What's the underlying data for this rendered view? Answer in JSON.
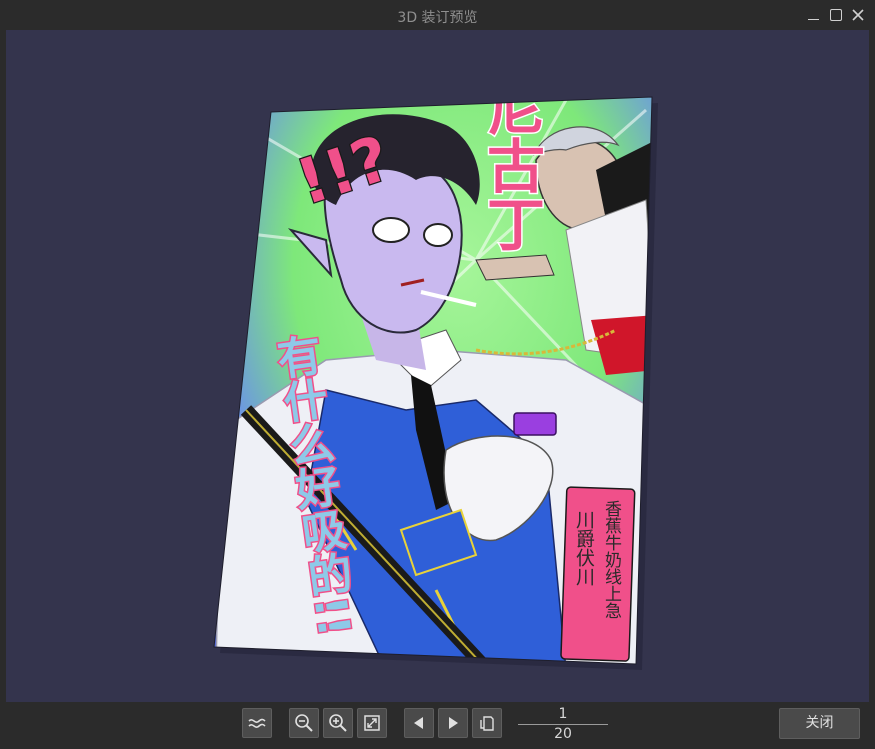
{
  "window": {
    "title": "3D 装订预览"
  },
  "cover": {
    "title_vertical": "尼古丁",
    "slogan_vertical": "有什么好吸的!!",
    "exclamation": "!!?",
    "author_box_line1": "香蕉牛奶线上急",
    "author_box_line2": "川爵伏川"
  },
  "toolbar": {
    "current_page": "1",
    "total_pages": "20",
    "close_label": "关闭",
    "icons": [
      "page-curl-icon",
      "zoom-out-icon",
      "zoom-in-icon",
      "fit-window-icon",
      "prev-page-icon",
      "next-page-icon",
      "page-spread-icon"
    ]
  },
  "colors": {
    "viewport_bg": "#34344d",
    "cover_green": "#7ee87a",
    "cover_blue": "#5a76e8",
    "title_pink": "#f0508a"
  }
}
